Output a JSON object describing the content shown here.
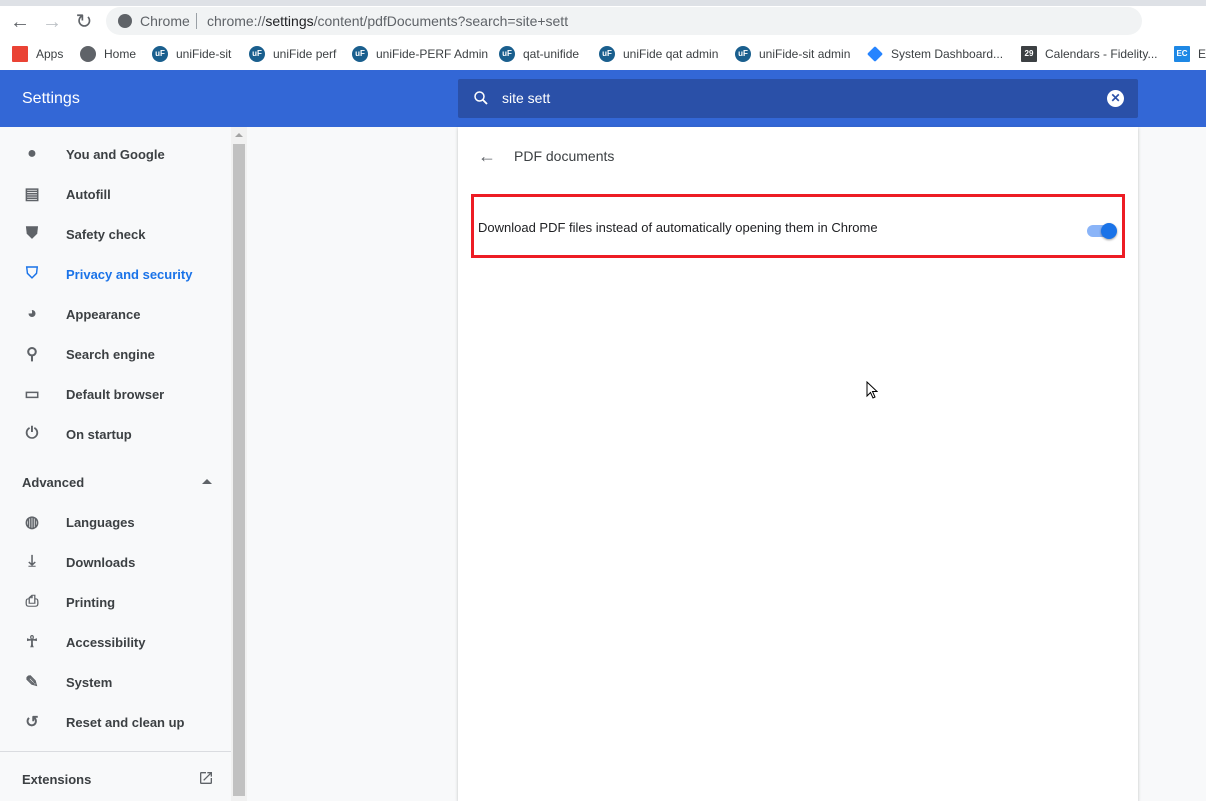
{
  "browser": {
    "omnibox": {
      "scheme_label": "Chrome",
      "url_host": "chrome://",
      "url_bold": "settings",
      "url_path": "/content/pdfDocuments?search=site+sett"
    },
    "bookmarks": [
      {
        "label": "Apps",
        "icon": "apps-grid-icon"
      },
      {
        "label": "Home",
        "icon": "globe-icon"
      },
      {
        "label": "uniFide-sit",
        "icon": "unifide-icon"
      },
      {
        "label": "uniFide perf",
        "icon": "unifide-icon"
      },
      {
        "label": "uniFide-PERF Admin",
        "icon": "unifide-icon"
      },
      {
        "label": "qat-unifide",
        "icon": "unifide-icon"
      },
      {
        "label": "uniFide qat admin",
        "icon": "unifide-icon"
      },
      {
        "label": "uniFide-sit admin",
        "icon": "unifide-icon"
      },
      {
        "label": "System Dashboard...",
        "icon": "jira-icon"
      },
      {
        "label": "Calendars - Fidelity...",
        "icon": "calendar-icon"
      },
      {
        "label": "E",
        "icon": "ec-icon"
      }
    ]
  },
  "header": {
    "title": "Settings",
    "search_value": "site sett"
  },
  "sidebar": {
    "items": [
      {
        "label": "You and Google",
        "icon": "person-icon"
      },
      {
        "label": "Autofill",
        "icon": "clipboard-icon"
      },
      {
        "label": "Safety check",
        "icon": "shield-check-icon"
      },
      {
        "label": "Privacy and security",
        "icon": "shield-icon",
        "active": true
      },
      {
        "label": "Appearance",
        "icon": "palette-icon"
      },
      {
        "label": "Search engine",
        "icon": "search-icon"
      },
      {
        "label": "Default browser",
        "icon": "browser-icon"
      },
      {
        "label": "On startup",
        "icon": "power-icon"
      }
    ],
    "advanced_label": "Advanced",
    "advanced_items": [
      {
        "label": "Languages",
        "icon": "globe-icon"
      },
      {
        "label": "Downloads",
        "icon": "download-icon"
      },
      {
        "label": "Printing",
        "icon": "printer-icon"
      },
      {
        "label": "Accessibility",
        "icon": "accessibility-icon"
      },
      {
        "label": "System",
        "icon": "wrench-icon"
      },
      {
        "label": "Reset and clean up",
        "icon": "history-icon"
      }
    ],
    "extensions_label": "Extensions"
  },
  "content": {
    "title": "PDF documents",
    "setting_label": "Download PDF files instead of automatically opening them in Chrome",
    "setting_enabled": true
  },
  "colors": {
    "accent": "#3367d6",
    "active": "#1a73e8",
    "highlight": "#ed1c24"
  }
}
